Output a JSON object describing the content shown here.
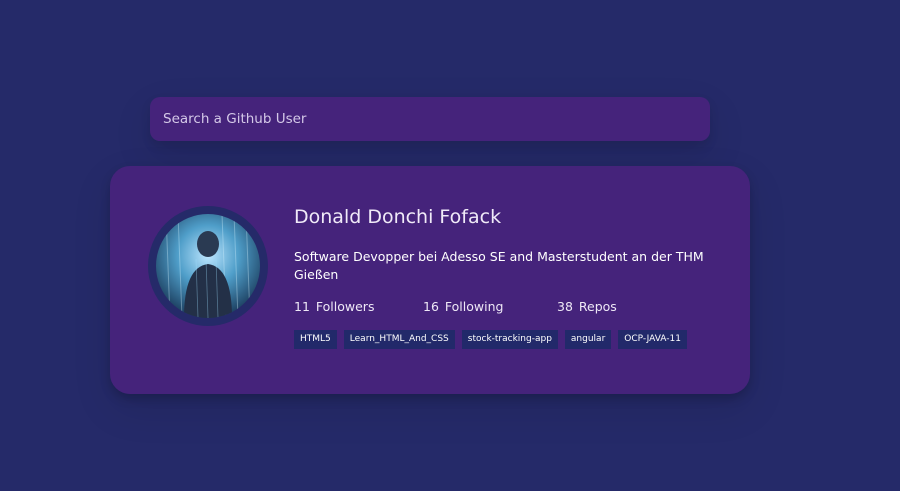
{
  "search": {
    "placeholder": "Search a Github User",
    "value": ""
  },
  "profile": {
    "name": "Donald Donchi Fofack",
    "bio": "Software Devopper bei Adesso SE and Masterstudent an der THM Gießen",
    "stats": {
      "followers_count": "11",
      "followers_label": "Followers",
      "following_count": "16",
      "following_label": "Following",
      "repos_count": "38",
      "repos_label": "Repos"
    },
    "repos": [
      "HTML5",
      "Learn_HTML_And_CSS",
      "stock-tracking-app",
      "angular",
      "OCP-JAVA-11"
    ]
  },
  "colors": {
    "background": "#252a69",
    "card": "#45237b",
    "tag": "#22296a"
  }
}
